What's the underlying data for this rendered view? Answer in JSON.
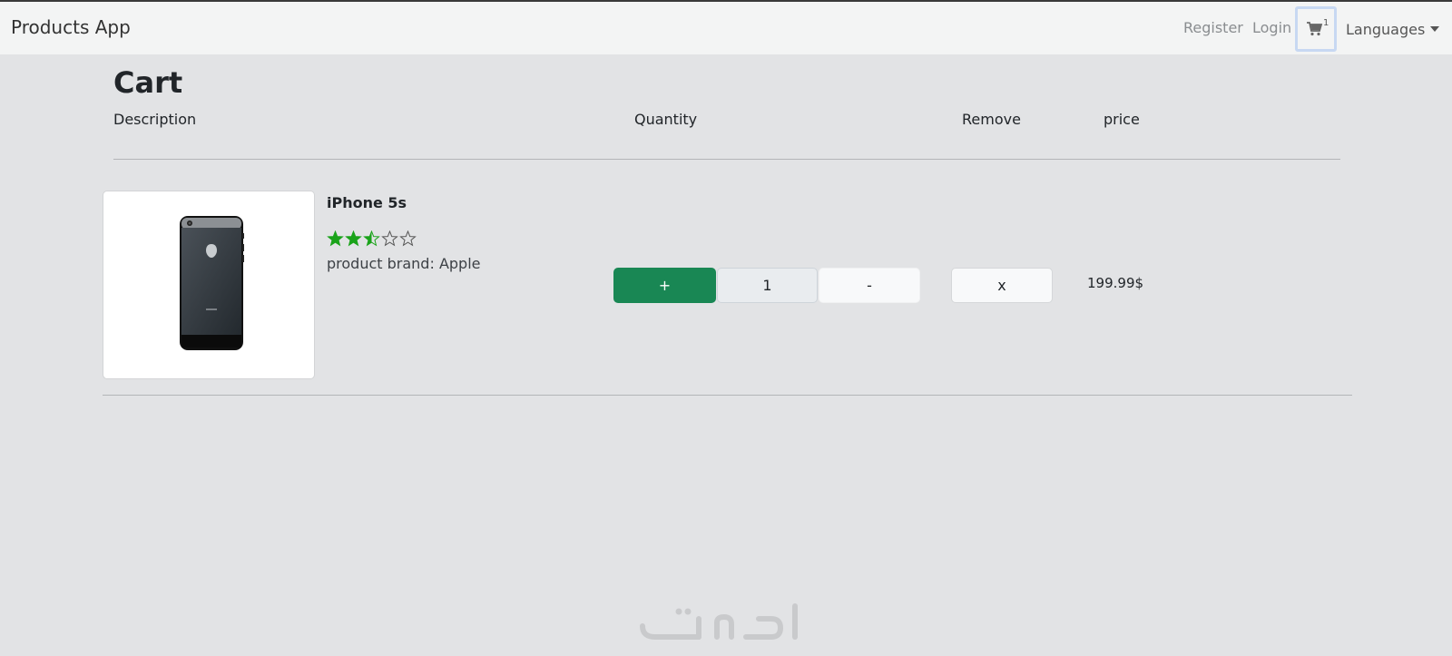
{
  "navbar": {
    "brand": "Products App",
    "register": "Register",
    "login": "Login",
    "cart_count": "1",
    "languages": "Languages"
  },
  "cart": {
    "title": "Cart",
    "columns": [
      "Description",
      "Quantity",
      "Remove",
      "price"
    ],
    "items": [
      {
        "name": "iPhone 5s",
        "rating": 2.5,
        "rating_max": 5,
        "brand_line": "product brand: Apple",
        "plus_label": "+",
        "quantity": "1",
        "minus_label": "-",
        "remove_label": "x",
        "price": "199.99$"
      }
    ]
  },
  "colors": {
    "accent_green": "#198754",
    "star_green": "#1aa31a",
    "page_bg": "#e2e3e5",
    "navbar_bg": "#f3f4f4"
  },
  "icons": [
    "cart-icon",
    "star-icon",
    "caret-down-icon",
    "phone-image"
  ]
}
